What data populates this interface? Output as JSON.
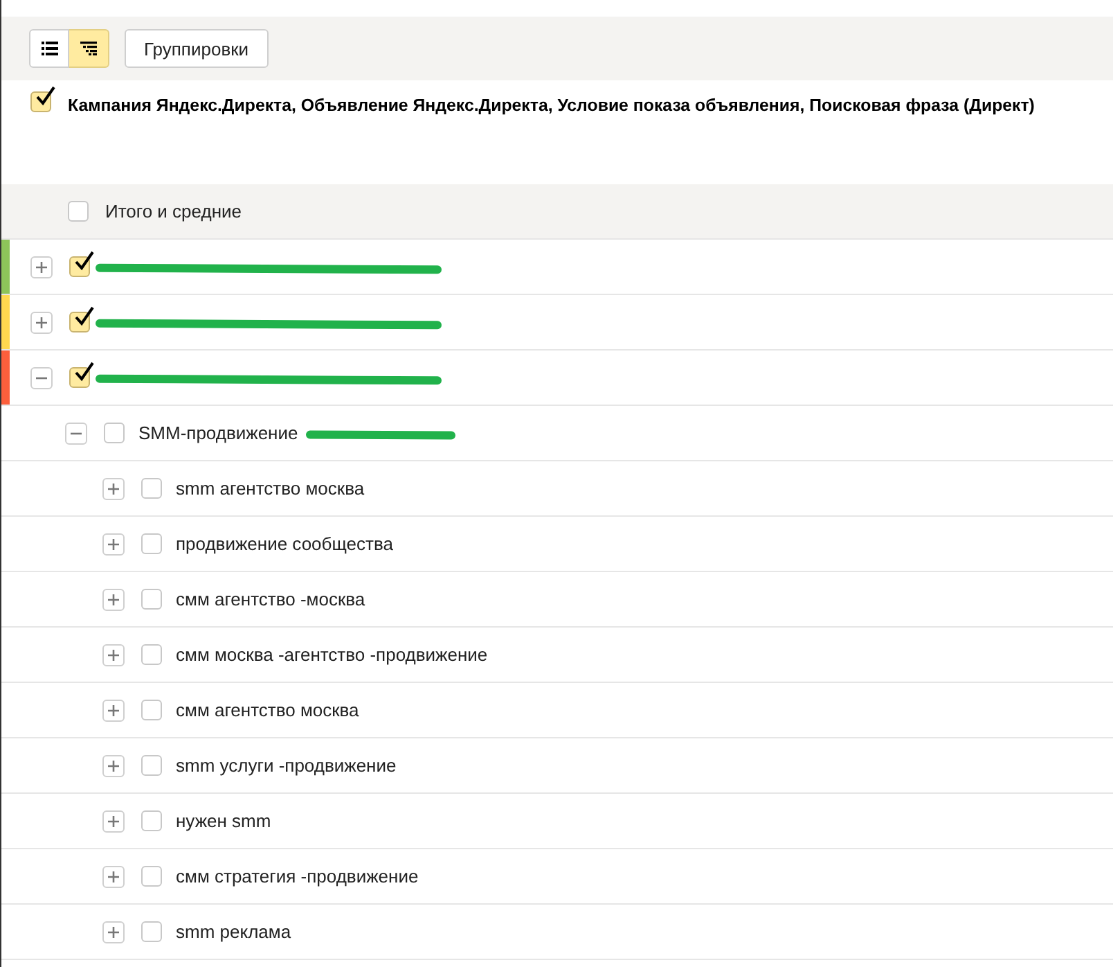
{
  "toolbar": {
    "view_modes": [
      {
        "kind": "list",
        "selected": false
      },
      {
        "kind": "tree",
        "selected": true
      }
    ],
    "groupings_button": "Группировки"
  },
  "grouping": {
    "checked": true,
    "label": "Кампания Яндекс.Директа, Объявление Яндекс.Директа, Условие показа объявления, Поисковая фраза (Директ)"
  },
  "totals": {
    "checked": false,
    "label": "Итого и средние"
  },
  "tree": [
    {
      "redacted": true,
      "color": "#8dc45a",
      "expanded": false,
      "checked": true
    },
    {
      "redacted": true,
      "color": "#ffd84f",
      "expanded": false,
      "checked": true
    },
    {
      "redacted": true,
      "color": "#fc5f3c",
      "expanded": true,
      "checked": true,
      "children": [
        {
          "label": "SMM-продвижение",
          "redacted": true,
          "expanded": true,
          "checked": false,
          "children": [
            {
              "label": "smm агентство москва",
              "expanded": false,
              "checked": false
            },
            {
              "label": "продвижение сообщества",
              "expanded": false,
              "checked": false
            },
            {
              "label": "смм агентство -москва",
              "expanded": false,
              "checked": false
            },
            {
              "label": "смм москва -агентство -продвижение",
              "expanded": false,
              "checked": false
            },
            {
              "label": "смм агентство москва",
              "expanded": false,
              "checked": false
            },
            {
              "label": "smm услуги -продвижение",
              "expanded": false,
              "checked": false
            },
            {
              "label": "нужен smm",
              "expanded": false,
              "checked": false
            },
            {
              "label": "смм стратегия -продвижение",
              "expanded": false,
              "checked": false
            },
            {
              "label": "smm реклама",
              "expanded": false,
              "checked": false
            }
          ]
        }
      ]
    }
  ]
}
